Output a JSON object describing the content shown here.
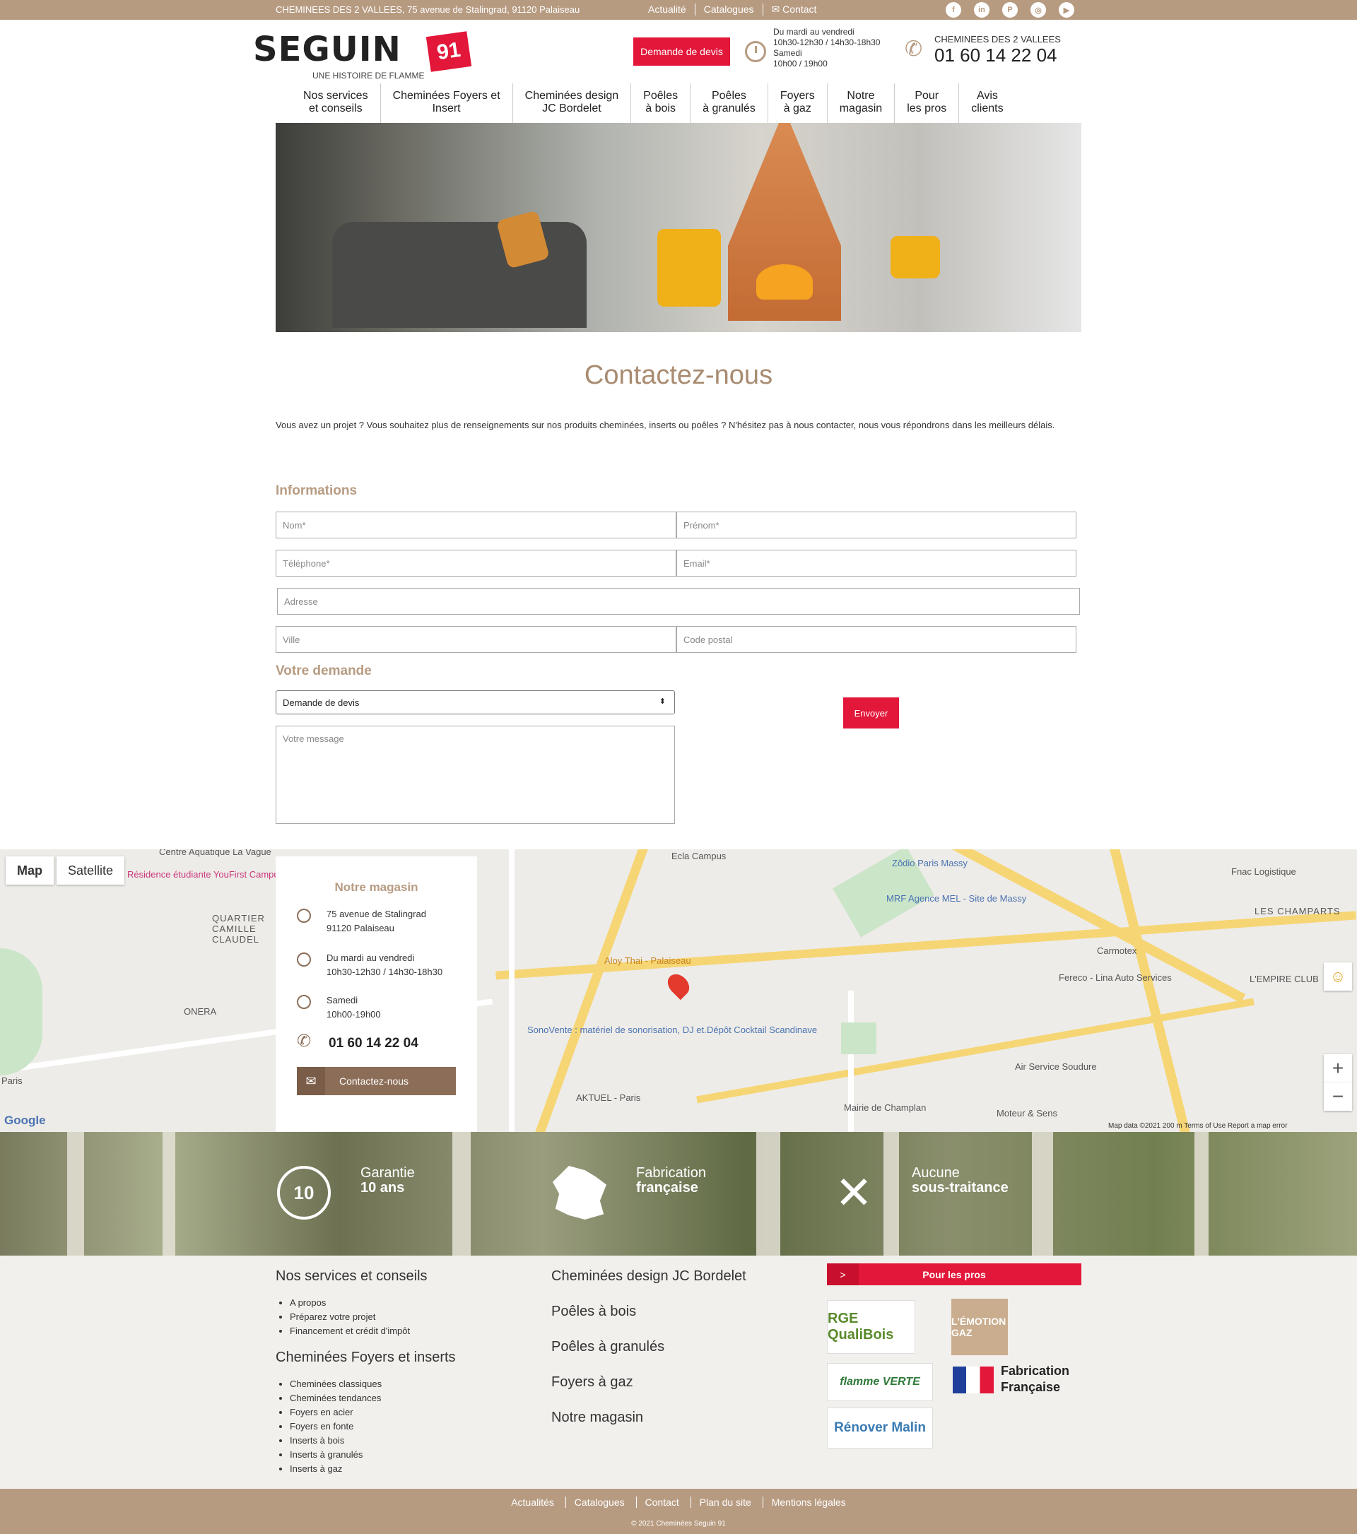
{
  "topbar": {
    "address": "CHEMINEES DES 2 VALLEES, 75 avenue de Stalingrad, 91120 Palaiseau",
    "links": [
      "Actualité",
      "Catalogues",
      "Contact"
    ],
    "social": [
      "facebook-icon",
      "linkedin-icon",
      "pinterest-icon",
      "instagram-icon",
      "youtube-icon"
    ]
  },
  "header": {
    "logo_word": "SEGUIN",
    "logo_badge": "91",
    "logo_tagline": "UNE HISTOIRE DE FLAMME",
    "devis": "Demande de devis",
    "hours": [
      "Du mardi au vendredi",
      "10h30-12h30 / 14h30-18h30",
      "Samedi",
      "10h00 / 19h00"
    ],
    "phone_label": "CHEMINEES DES 2 VALLEES",
    "phone": "01 60 14 22 04"
  },
  "nav": [
    [
      "Nos services",
      "et conseils"
    ],
    [
      "Cheminées Foyers et",
      "Insert"
    ],
    [
      "Cheminées design",
      "JC Bordelet"
    ],
    [
      "Poêles",
      "à bois"
    ],
    [
      "Poêles",
      "à granulés"
    ],
    [
      "Foyers",
      "à gaz"
    ],
    [
      "Notre",
      "magasin"
    ],
    [
      "Pour",
      "les pros"
    ],
    [
      "Avis",
      "clients"
    ]
  ],
  "page": {
    "title": "Contactez-nous",
    "intro": "Vous avez un projet ? Vous souhaitez plus de renseignements sur nos produits cheminées, inserts ou poêles ? N'hésitez pas à nous contacter, nous vous répondrons dans les meilleurs délais."
  },
  "form": {
    "info_heading": "Informations",
    "nom": "Nom*",
    "prenom": "Prénom*",
    "telephone": "Téléphone*",
    "email": "Email*",
    "adresse": "Adresse",
    "ville": "Ville",
    "code_postal": "Code postal",
    "demande_heading": "Votre demande",
    "select_value": "Demande de devis",
    "message": "Votre message",
    "submit": "Envoyer"
  },
  "map": {
    "tab_map": "Map",
    "tab_satellite": "Satellite",
    "labels": [
      "Centre Aquatique La Vague",
      "Résidence étudiante YouFirst Campus Paris...",
      "Ecla Campus",
      "Zôdio Paris Massy",
      "MRF Agence MEL - Site de Massy",
      "Aloy Thai - Palaiseau",
      "Dépôt Cocktail Scandinave",
      "SonoVente : matériel de sonorisation, DJ et...",
      "AKTUEL - Paris",
      "Carmotex",
      "Fereco - Lina Auto Services",
      "L'EMPIRE CLUB",
      "Air Service Soudure",
      "Mairie de Champlan",
      "Moteur & Sens",
      "Fnac Logistique",
      "LES CHAMPARTS",
      "ONERA",
      "Paris",
      "QUARTIER CAMILLE CLAUDEL"
    ],
    "footer": "Map data ©2021   200 m   Terms of Use   Report a map error",
    "google": "Google"
  },
  "store": {
    "heading": "Notre magasin",
    "address": [
      "75 avenue de Stalingrad",
      "91120 Palaiseau"
    ],
    "weekdays": [
      "Du mardi au vendredi",
      "10h30-12h30 / 14h30-18h30"
    ],
    "saturday": [
      "Samedi",
      "10h00-19h00"
    ],
    "phone": "01 60 14 22 04",
    "cta": "Contactez-nous"
  },
  "usp": [
    {
      "line1": "Garantie",
      "line2": "10 ans"
    },
    {
      "line1": "Fabrication",
      "line2": "française"
    },
    {
      "line1": "Aucune",
      "line2": "sous-traitance"
    }
  ],
  "footer": {
    "col1_h1": "Nos services et conseils",
    "col1_list1": [
      "A propos",
      "Préparez votre projet",
      "Financement et crédit d'impôt"
    ],
    "col1_h2": "Cheminées Foyers et inserts",
    "col1_list2": [
      "Cheminées classiques",
      "Cheminées tendances",
      "Foyers en acier",
      "Foyers en fonte",
      "Inserts à bois",
      "Inserts à granulés",
      "Inserts à gaz"
    ],
    "col2": [
      "Cheminées design JC Bordelet",
      "Poêles à bois",
      "Poêles à granulés",
      "Foyers à gaz",
      "Notre magasin"
    ],
    "pros": "Pour les pros",
    "pros_arrow": ">",
    "logos": [
      "RGE QualiBois",
      "L'ÉMOTION GAZ",
      "flamme VERTE",
      "Fabrication Française",
      "Rénover Malin"
    ]
  },
  "bottom": {
    "links": [
      "Actualités",
      "Catalogues",
      "Contact",
      "Plan du site",
      "Mentions légales"
    ],
    "copyright": "© 2021 Cheminées Seguin 91"
  },
  "colors": {
    "brand_brown": "#b79b81",
    "brand_red": "#e2173a",
    "dark_brown": "#8c6e58"
  }
}
